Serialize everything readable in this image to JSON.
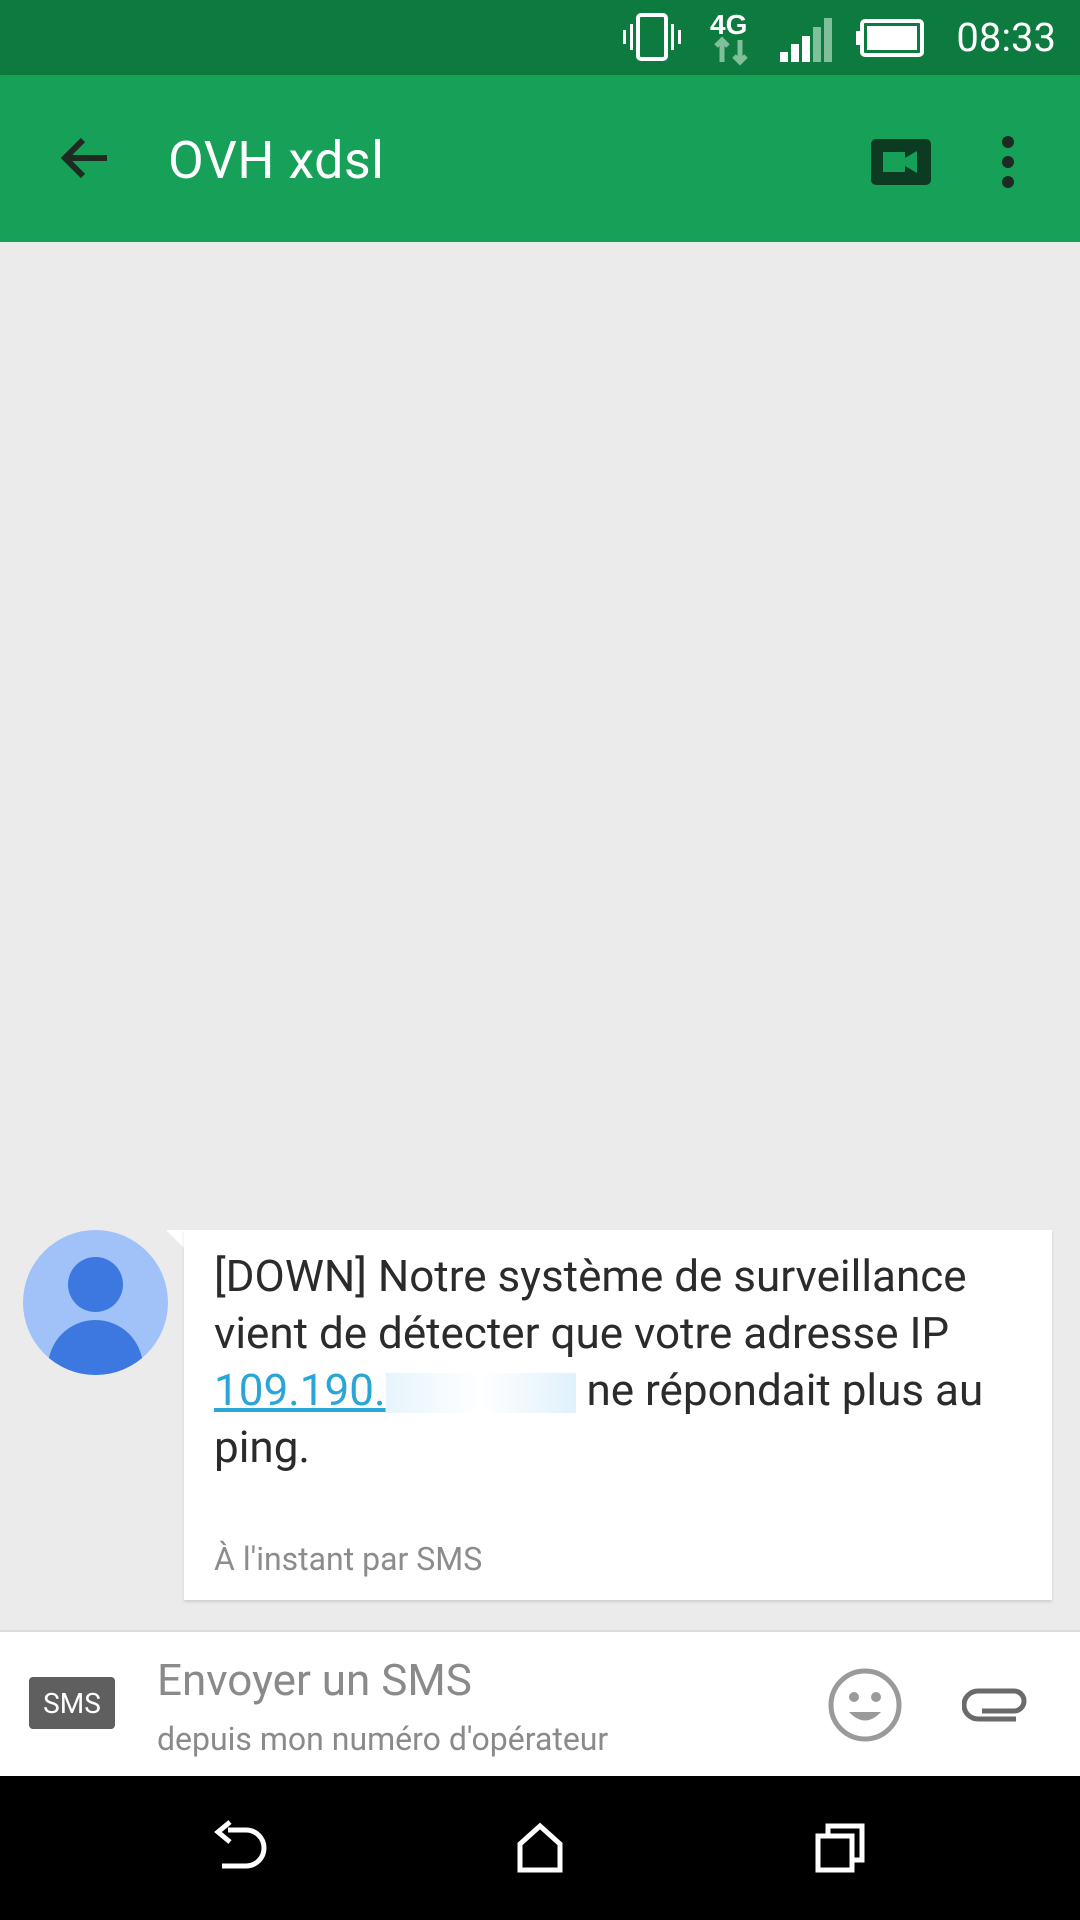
{
  "status_bar": {
    "time": "08:33",
    "network": "4G",
    "icons": [
      "vibrate-icon",
      "network-4g-icon",
      "signal-icon",
      "battery-icon"
    ]
  },
  "app_bar": {
    "title": "OVH xdsl",
    "icons": [
      "back-arrow-icon",
      "video-call-icon",
      "more-vert-icon"
    ],
    "color": "#16a058"
  },
  "message": {
    "text_before_ip": "[DOWN] Notre système de surveillance vient de détecter que votre adresse IP ",
    "ip_visible": "109.190.",
    "text_after_ip": " ne répondait plus au ping.",
    "meta": "À l'instant par SMS",
    "avatar_icon": "person-icon",
    "avatar_color": "#a0c2f9"
  },
  "composer": {
    "badge": "SMS",
    "placeholder": "Envoyer un SMS",
    "subtext": "depuis mon numéro d'opérateur",
    "icons": [
      "emoji-icon",
      "attach-icon"
    ]
  },
  "nav_bar": {
    "icons": [
      "nav-back-icon",
      "nav-home-icon",
      "nav-recents-icon"
    ]
  }
}
